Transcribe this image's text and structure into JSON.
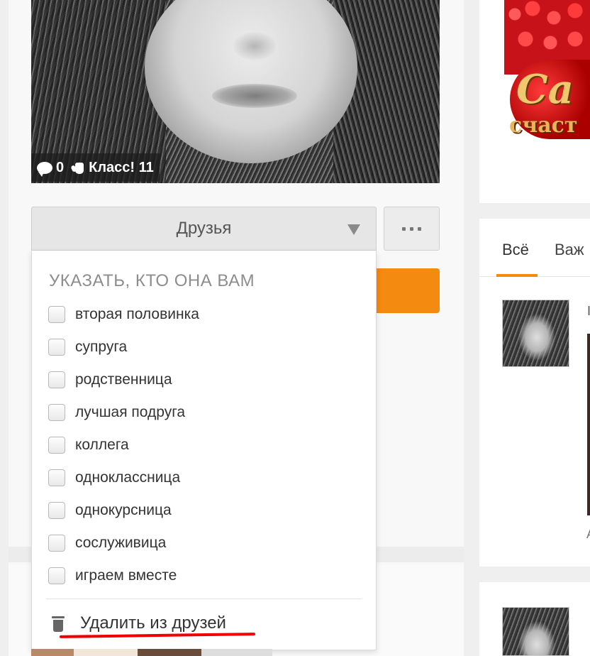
{
  "photo": {
    "comments_count": "0",
    "klass_label": "Класс! 11"
  },
  "friends_select": {
    "label": "Друзья"
  },
  "dropdown": {
    "title": "УКАЗАТЬ, КТО ОНА ВАМ",
    "options": [
      "вторая половинка",
      "супруга",
      "родственница",
      "лучшая подруга",
      "коллега",
      "одноклассница",
      "однокурсница",
      "сослуживица",
      "играем вместе"
    ],
    "remove_label": "Удалить из друзей"
  },
  "right_column": {
    "banner_text_line1": "Са",
    "banner_text_line2": "счаст",
    "tabs": [
      "Всё",
      "Важ"
    ],
    "ghost_char_1": "I",
    "ghost_char_2": "A"
  },
  "colors": {
    "accent_orange": "#f48a0f",
    "highlight_red": "#e00000"
  }
}
